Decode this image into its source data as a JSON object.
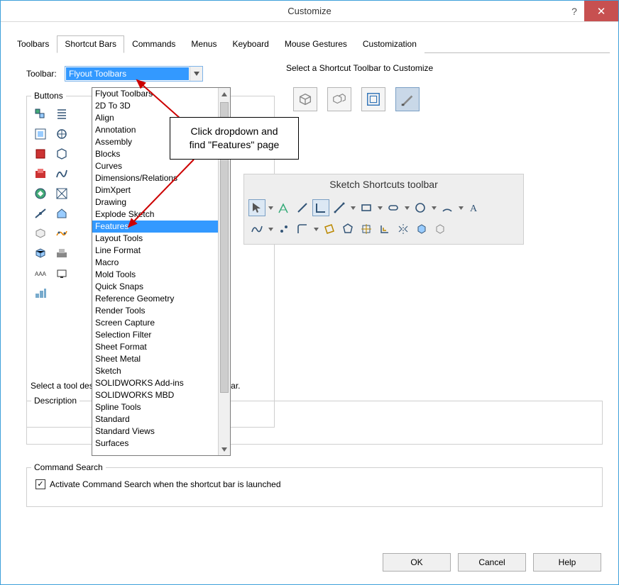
{
  "window": {
    "title": "Customize"
  },
  "tabs": [
    "Toolbars",
    "Shortcut Bars",
    "Commands",
    "Menus",
    "Keyboard",
    "Mouse Gestures",
    "Customization"
  ],
  "active_tab": 1,
  "toolbar_label": "Toolbar:",
  "toolbar_selected": "Flyout Toolbars",
  "select_prompt": "Select a Shortcut Toolbar to Customize",
  "buttons_group_label": "Buttons",
  "dropdown_items": [
    "Flyout Toolbars",
    "2D To 3D",
    "Align",
    "Annotation",
    "Assembly",
    "Blocks",
    "Curves",
    "Dimensions/Relations",
    "DimXpert",
    "Drawing",
    "Explode Sketch",
    "Features",
    "Layout Tools",
    "Line Format",
    "Macro",
    "Mold Tools",
    "Quick Snaps",
    "Reference Geometry",
    "Render Tools",
    "Screen Capture",
    "Selection Filter",
    "Sheet Format",
    "Sheet Metal",
    "Sketch",
    "SOLIDWORKS Add-ins",
    "SOLIDWORKS MBD",
    "Spline Tools",
    "Standard",
    "Standard Views",
    "Surfaces"
  ],
  "dropdown_highlight": 11,
  "callout_line1": "Click dropdown and",
  "callout_line2": "find \"Features\" page",
  "sketch_toolbar_title": "Sketch Shortcuts toolbar",
  "hint_text": "Select a tool                                                              description. Drag the button to any toolbar.",
  "description_label": "Description",
  "command_search_label": "Command Search",
  "command_search_checkbox": "Activate Command Search when the shortcut bar is launched",
  "footer": {
    "ok": "OK",
    "cancel": "Cancel",
    "help": "Help"
  }
}
